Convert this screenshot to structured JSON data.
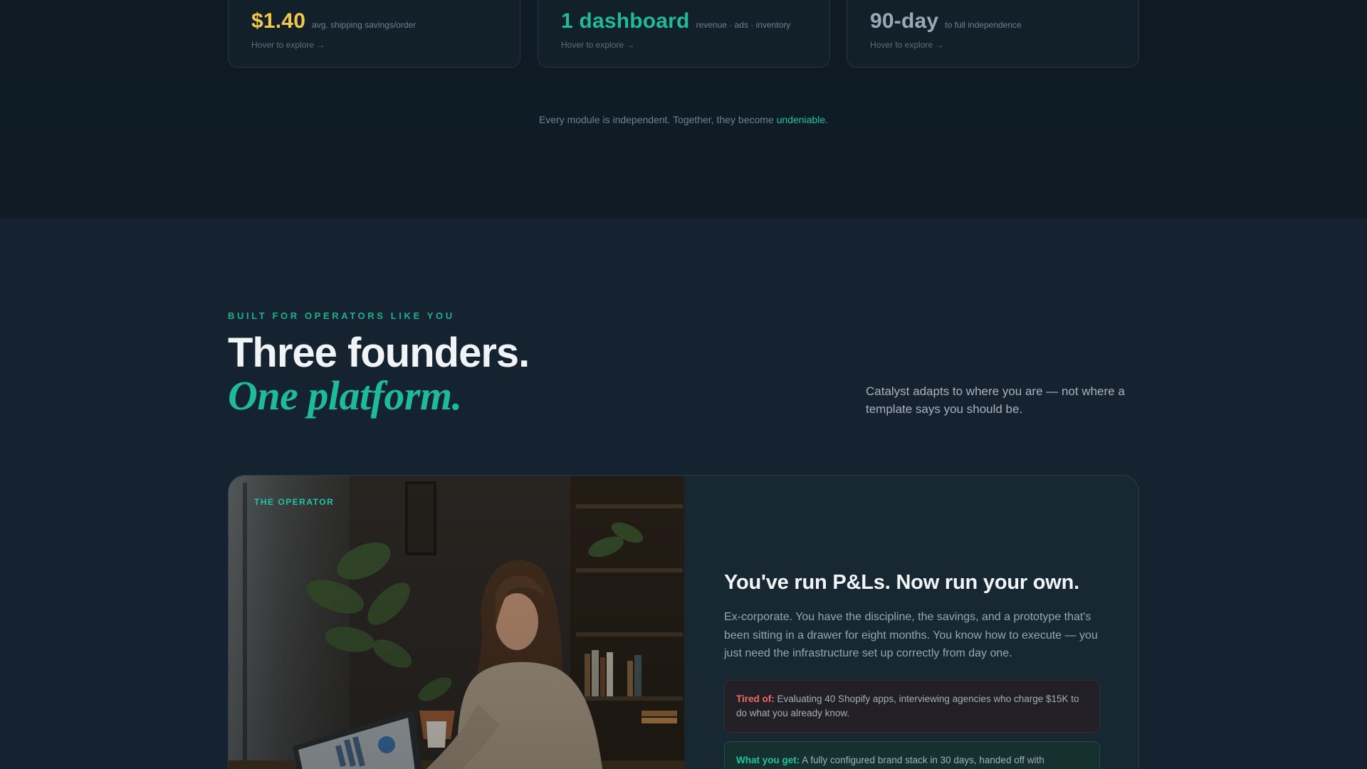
{
  "stats": [
    {
      "value": "$1.40",
      "desc": "avg. shipping savings/order",
      "hint": "Hover to explore →",
      "color": "#f2c84b"
    },
    {
      "value": "1 dashboard",
      "desc": "revenue · ads · inventory",
      "hint": "Hover to explore →",
      "color": "#21b99b"
    },
    {
      "value": "90-day",
      "desc": "to full independence",
      "hint": "Hover to explore →",
      "color": "#9aa9b4"
    }
  ],
  "together": {
    "prefix": "Every module is independent. Together, they become ",
    "highlight": "undeniable",
    "suffix": "."
  },
  "founders": {
    "eyebrow": "BUILT FOR OPERATORS LIKE YOU",
    "headline": "Three founders.",
    "headline_italic": "One platform.",
    "side_blurb": "Catalyst adapts to where you are — not where a template says you should be."
  },
  "persona": {
    "tag": "THE OPERATOR",
    "title": "You've run P&Ls. Now run your own.",
    "body": "Ex-corporate. You have the discipline, the savings, and a prototype that's been sitting in a drawer for eight months. You know how to execute — you just need the infrastructure set up correctly from day one.",
    "tired_label": "Tired of:",
    "tired_text": " Evaluating 40 Shopify apps, interviewing agencies who charge $15K to do what you already know.",
    "get_label": "What you get:",
    "get_text": " A fully configured brand stack in 30 days, handed off with"
  },
  "colors": {
    "accent_teal": "#21c4a2",
    "gold": "#f2c84b",
    "warning_red": "#f06a6a",
    "page_bg": "#15222f"
  }
}
